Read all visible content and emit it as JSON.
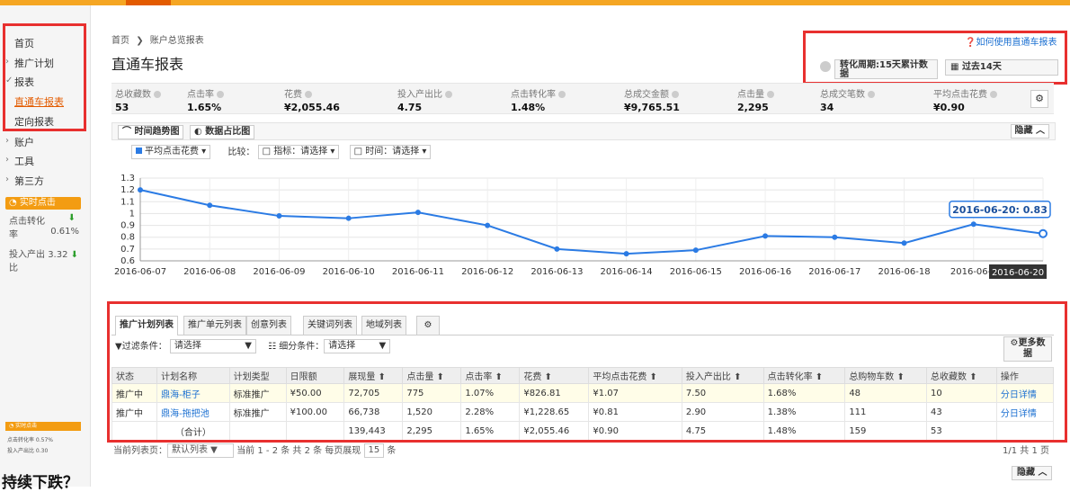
{
  "sidebar": {
    "items": [
      "首页",
      "推广计划",
      "报表",
      "直通车报表",
      "定向报表",
      "账户",
      "工具",
      "第三方"
    ],
    "realtime_tag": "实时点击",
    "metrics": [
      {
        "label_line1": "点击转化",
        "label_line2": "率",
        "value": "0.61%"
      },
      {
        "label_line1": "投入产出",
        "value": "3.32",
        "label_line2": "比"
      }
    ],
    "small_tag": "实时点击",
    "small_metrics": [
      "点击转化率 0.57%",
      "投入产出比 0.30"
    ]
  },
  "breadcrumb": {
    "home": "首页",
    "current": "账户总览报表"
  },
  "page_title": "直通车报表",
  "help_link": "如何使用直通车报表",
  "conversion_period": "转化周期:15天累计数据",
  "date_range": "过去14天",
  "stats": [
    {
      "label": "总收藏数",
      "value": "53"
    },
    {
      "label": "点击率",
      "value": "1.65%"
    },
    {
      "label": "花费",
      "value": "¥2,055.46"
    },
    {
      "label": "投入产出比",
      "value": "4.75"
    },
    {
      "label": "点击转化率",
      "value": "1.48%"
    },
    {
      "label": "总成交金额",
      "value": "¥9,765.51"
    },
    {
      "label": "点击量",
      "value": "2,295"
    },
    {
      "label": "总成交笔数",
      "value": "34"
    },
    {
      "label": "平均点击花费",
      "value": "¥0.90"
    }
  ],
  "chart_tabs": {
    "trend": "时间趋势图",
    "share": "数据占比图",
    "hide": "隐藏"
  },
  "chart_controls": {
    "metric": "平均点击花费",
    "compare_label": "比较：",
    "indicator": "指标：请选择",
    "time": "时间：请选择"
  },
  "chart_data": {
    "type": "line",
    "x": [
      "2016-06-07",
      "2016-06-08",
      "2016-06-09",
      "2016-06-10",
      "2016-06-11",
      "2016-06-12",
      "2016-06-13",
      "2016-06-14",
      "2016-06-15",
      "2016-06-16",
      "2016-06-17",
      "2016-06-18",
      "2016-06-19",
      "2016-06-20"
    ],
    "x_tick_labels": [
      "2016-06-07",
      "2016-06-08",
      "2016-06-09",
      "2016-06-10",
      "2016-06-11",
      "2016-06-12",
      "2016-06-13",
      "2016-06-14",
      "2016-06-15",
      "2016-06-16",
      "2016-06-17",
      "2016-06-18",
      "2016-06-1"
    ],
    "series": [
      {
        "name": "平均点击花费",
        "values": [
          1.2,
          1.07,
          0.98,
          0.96,
          1.01,
          0.9,
          0.7,
          0.66,
          0.69,
          0.81,
          0.8,
          0.75,
          0.91,
          0.83
        ]
      }
    ],
    "ylim": [
      0.6,
      1.3
    ],
    "yticks": [
      "1.3",
      "1.2",
      "1.1",
      "1",
      "0.9",
      "0.8",
      "0.7",
      "0.6"
    ],
    "tooltip": "2016-06-20: 0.83",
    "crosshair_label": "2016-06-20",
    "grid": true,
    "line_color": "#2b7be4"
  },
  "table_tabs": [
    "推广计划列表",
    "推广单元列表",
    "创意列表",
    "关键词列表",
    "地域列表"
  ],
  "filter": {
    "label": "过滤条件：",
    "value": "请选择",
    "sub_label": "细分条件：",
    "sub_value": "请选择",
    "more": "更多数据"
  },
  "table": {
    "headers": [
      "状态",
      "计划名称",
      "计划类型",
      "日限额",
      "展现量",
      "点击量",
      "点击率",
      "花费",
      "平均点击花费",
      "投入产出比",
      "点击转化率",
      "总购物车数",
      "总收藏数",
      "操作"
    ],
    "rows": [
      [
        "推广中",
        "鼎海-柜子",
        "标准推广",
        "¥50.00",
        "72,705",
        "775",
        "1.07%",
        "¥826.81",
        "¥1.07",
        "7.50",
        "1.68%",
        "48",
        "10",
        "分日详情"
      ],
      [
        "推广中",
        "鼎海-拖把池",
        "标准推广",
        "¥100.00",
        "66,738",
        "1,520",
        "2.28%",
        "¥1,228.65",
        "¥0.81",
        "2.90",
        "1.38%",
        "111",
        "43",
        "分日详情"
      ],
      [
        "",
        "（合计）",
        "",
        "",
        "139,443",
        "2,295",
        "1.65%",
        "¥2,055.46",
        "¥0.90",
        "4.75",
        "1.48%",
        "159",
        "53",
        ""
      ]
    ]
  },
  "pager": {
    "text1": "当前列表页：",
    "view": "默认列表",
    "text2": "当前 1 - 2 条  共 2 条  每页展现",
    "per": "15",
    "text3": "条",
    "right": "1/1  共 1 页"
  },
  "hide2": "隐藏",
  "bottom_text": "持续下跌？",
  "colors": {
    "accent": "#e8302f",
    "orange": "#f39c12",
    "blue": "#1a6fd1"
  }
}
